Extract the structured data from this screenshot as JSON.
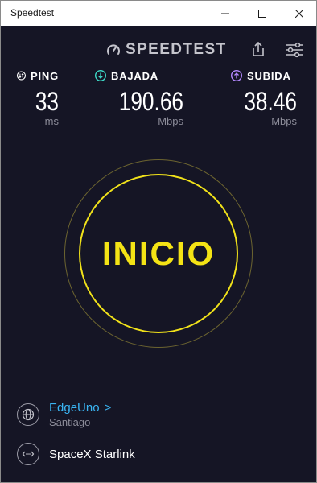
{
  "window": {
    "title": "Speedtest"
  },
  "header": {
    "brand": "SPEEDTEST"
  },
  "metrics": {
    "ping": {
      "label": "PING",
      "value": "33",
      "unit": "ms",
      "icon_color": "#ffffff"
    },
    "download": {
      "label": "BAJADA",
      "value": "190.66",
      "unit": "Mbps",
      "icon_color": "#3dd9c8"
    },
    "upload": {
      "label": "SUBIDA",
      "value": "38.46",
      "unit": "Mbps",
      "icon_color": "#b488ff"
    }
  },
  "start": {
    "label": "INICIO",
    "color": "#f4e315"
  },
  "server": {
    "provider": "EdgeUno",
    "provider_chevron": ">",
    "location": "Santiago"
  },
  "isp": {
    "name": "SpaceX Starlink"
  },
  "colors": {
    "background": "#151525",
    "accent_link": "#3ab4f2",
    "muted": "#8c8c99"
  }
}
